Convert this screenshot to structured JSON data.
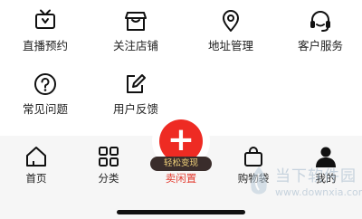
{
  "services": {
    "row1": [
      {
        "label": "直播预约",
        "icon": "tv-icon"
      },
      {
        "label": "关注店铺",
        "icon": "store-icon"
      },
      {
        "label": "地址管理",
        "icon": "location-pin-icon"
      },
      {
        "label": "客户服务",
        "icon": "headset-icon"
      }
    ],
    "row2": [
      {
        "label": "常见问题",
        "icon": "question-circle-icon"
      },
      {
        "label": "用户反馈",
        "icon": "edit-icon"
      }
    ]
  },
  "tabbar": {
    "home": "首页",
    "category": "分类",
    "sell_badge": "轻松变现",
    "sell_plus": "+",
    "sell": "卖闲置",
    "cart": "购物袋",
    "me": "我的"
  },
  "watermark": {
    "cn": "当下软件园",
    "url": "www.downxia.com"
  },
  "colors": {
    "accent": "#ee2b23",
    "badge_bg": "#3a2d2b",
    "badge_text": "#f3d37b",
    "tabbar_bg": "#f6f6f6"
  }
}
